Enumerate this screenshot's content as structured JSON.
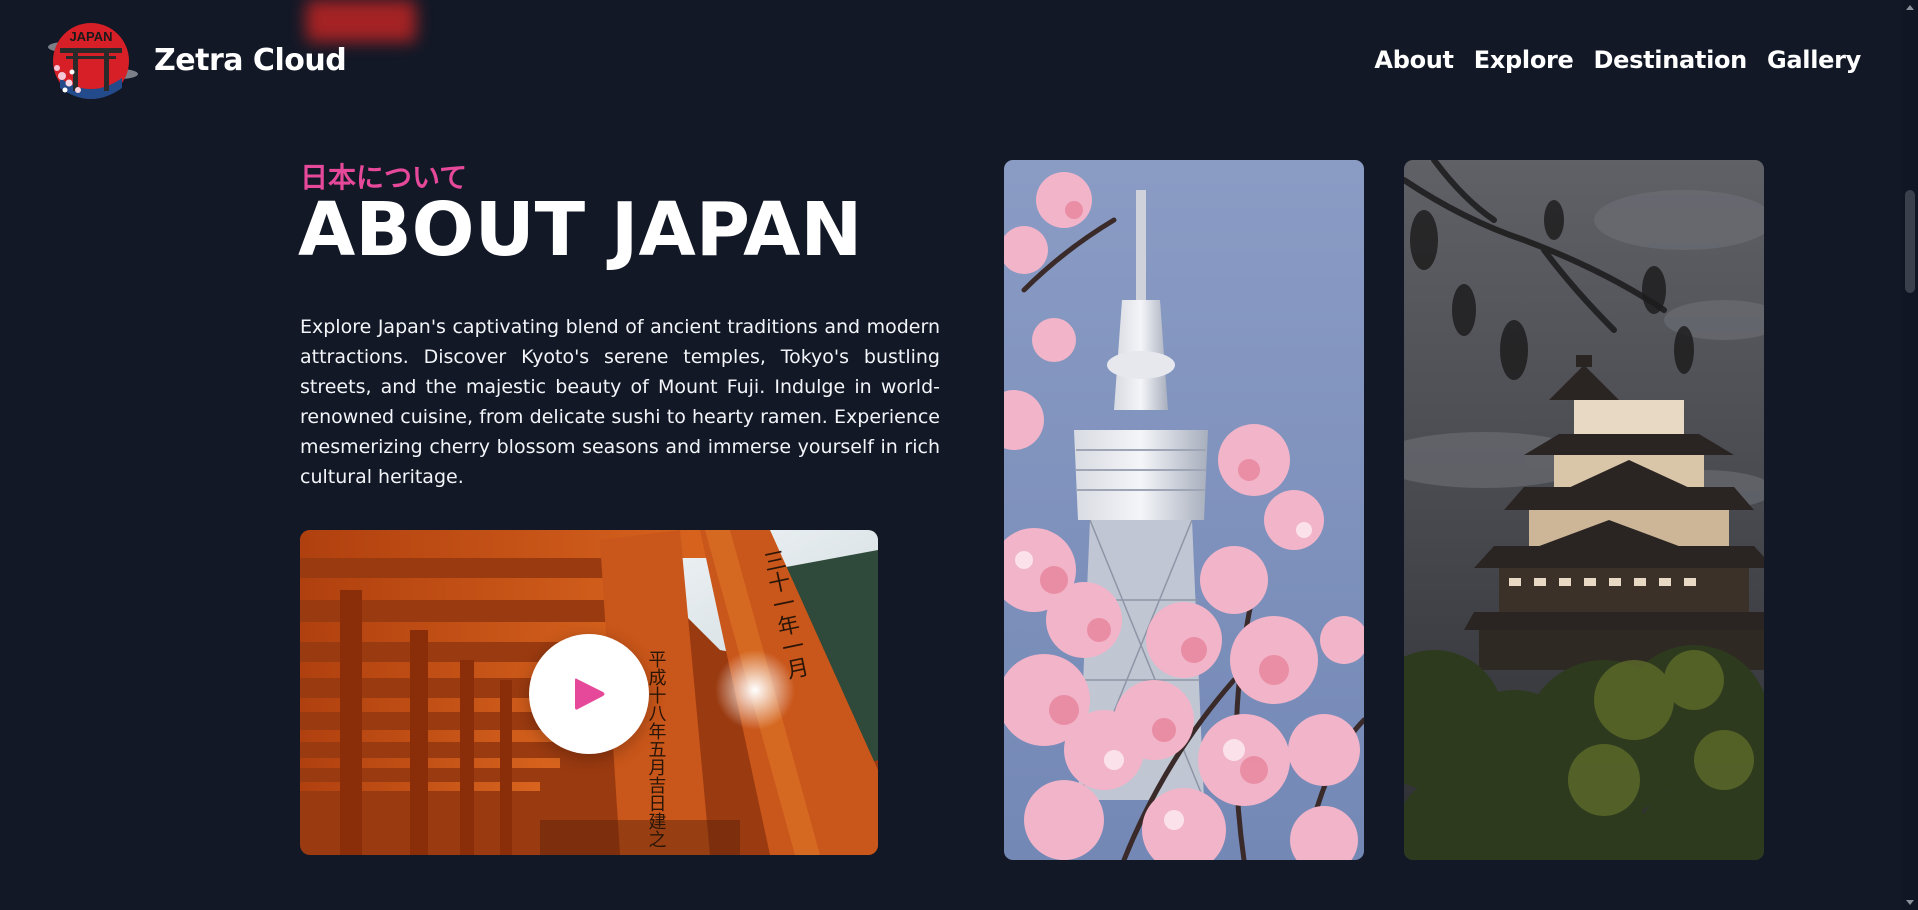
{
  "header": {
    "brand": "Zetra Cloud",
    "logo_text": "JAPAN",
    "nav": [
      "About",
      "Explore",
      "Destination",
      "Gallery"
    ]
  },
  "about": {
    "subtitle": "日本について",
    "title": "ABOUT JAPAN",
    "description": "Explore Japan's captivating blend of ancient traditions and modern attractions. Discover Kyoto's serene temples, Tokyo's bustling streets, and the majestic beauty of Mount Fuji. Indulge in world-renowned cuisine, from delicate sushi to hearty ramen. Experience mesmerizing cherry blossom seasons and immerse yourself in rich cultural heritage."
  },
  "video": {
    "play_icon": "play-icon",
    "inscription_1": "平成十八年五月吉日建之",
    "inscription_2": "三十一年一月"
  },
  "colors": {
    "background": "#121826",
    "accent": "#e6499a",
    "text": "#ffffff"
  }
}
